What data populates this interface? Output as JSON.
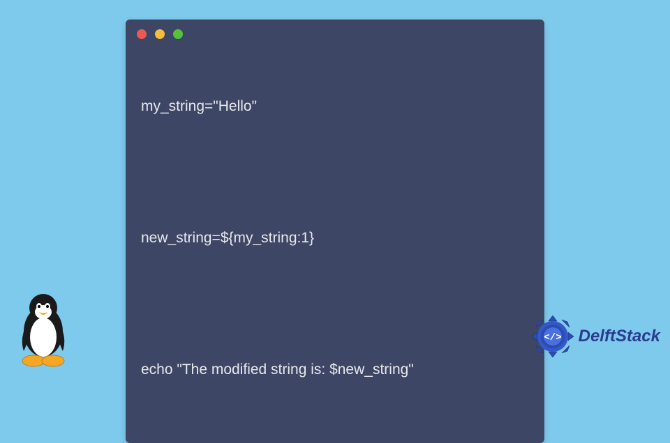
{
  "code": {
    "line1": "my_string=\"Hello\"",
    "line2": "new_string=${my_string:1}",
    "line3": "echo \"The modified string is: $new_string\""
  },
  "brand": {
    "name": "DelftStack"
  },
  "colors": {
    "background": "#7ecaed",
    "window": "#3d4665",
    "text": "#e8e8ed",
    "brand": "#2a3c8f"
  }
}
